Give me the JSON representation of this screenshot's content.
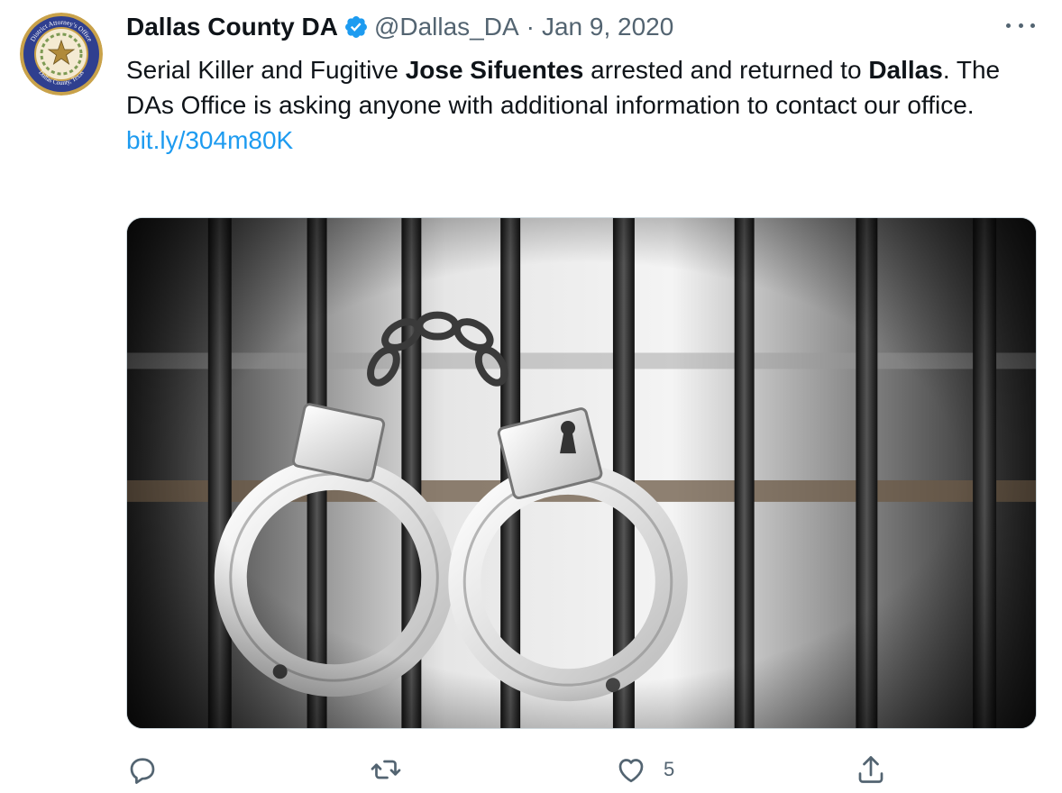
{
  "tweet": {
    "display_name": "Dallas County DA",
    "handle": "@Dallas_DA",
    "separator": "·",
    "date": "Jan 9, 2020",
    "text_parts": {
      "p1": "Serial Killer and Fugitive ",
      "b1": "Jose Sifuentes",
      "p2": " arrested and returned to ",
      "b2": "Dallas",
      "p3": ". The DAs Office is asking anyone with additional information to contact our office."
    },
    "link": "bit.ly/304m80K",
    "image_alt": "Handcuffs hanging on jail cell bars"
  },
  "avatar_seal": {
    "top_text": "District Attorney's Office",
    "bottom_text": "Dallas County, Texas"
  },
  "actions": {
    "reply_icon": "reply-icon",
    "retweet_icon": "retweet-icon",
    "like_icon": "heart-icon",
    "like_count": "5",
    "share_icon": "share-icon"
  },
  "colors": {
    "link": "#1d9bf0",
    "verified": "#1d9bf0",
    "secondary_text": "#536471",
    "seal_blue": "#2f3f8f",
    "seal_gold": "#c9a24a"
  }
}
